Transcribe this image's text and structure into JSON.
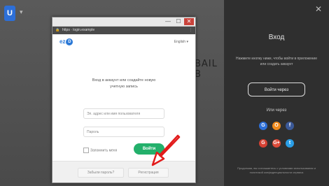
{
  "background": {
    "logo_letter": "U",
    "caret": "▾",
    "partial_text": "BAIL B"
  },
  "titlebar": {
    "minimize": "—",
    "maximize": "☐",
    "close": "✕"
  },
  "addressbar": {
    "lock": "🔒",
    "url": "https · login.example",
    "more": "⋮"
  },
  "dialog": {
    "brand_text": "ez",
    "brand_mark": "D",
    "language": "English ▾",
    "heading_line1": "Вход в аккаунт или создайте новую",
    "heading_line2": "учетную запись",
    "email_placeholder": "Эл. адрес или имя пользователя",
    "password_placeholder": "Пароль",
    "remember_label": "Запомнить меня",
    "login_button": "Войти",
    "footer_left": "Забыли пароль?",
    "footer_right": "Регистрация"
  },
  "right_panel": {
    "close": "✕",
    "title": "Вход",
    "description": "Нажмите кнопку ниже, чтобы войти в приложение или создать аккаунт",
    "login_button": "Войти через",
    "or_label": "Или через",
    "socials_row1": [
      "G",
      "O",
      "f"
    ],
    "socials_row2": [
      "G",
      "G+",
      "t"
    ],
    "social_colors_row1": [
      "#2d6fd8",
      "#f08a1c",
      "#3b5998"
    ],
    "social_colors_row2": [
      "#d54133",
      "#dd4b39",
      "#2a9ee6"
    ],
    "footer_text": "Продолжая, вы соглашаетесь с условиями использования и политикой конфиденциальности сервиса"
  },
  "annotation": {
    "arrow_color": "#e21b1b"
  }
}
